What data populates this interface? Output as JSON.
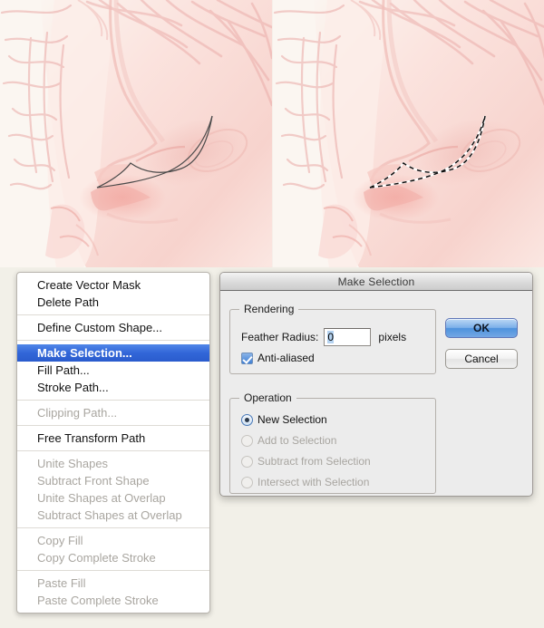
{
  "artwork": {
    "description": "digital-sketch-face-profile-lips",
    "left_panel_name": "path-view",
    "right_panel_name": "selection-view",
    "palette": {
      "paper": "#fbf6f1",
      "skin_light": "#fce7e2",
      "skin_mid": "#f6ccc6",
      "skin_shadow": "#eeb0ab",
      "sketch_line": "#e9a9a6",
      "path_stroke": "#4a4a4a",
      "marquee": "#111111"
    }
  },
  "context_menu": {
    "name": "paths-panel-context-menu",
    "groups": [
      {
        "items": [
          {
            "label": "Create Vector Mask",
            "state": "enabled"
          },
          {
            "label": "Delete Path",
            "state": "enabled"
          }
        ]
      },
      {
        "items": [
          {
            "label": "Define Custom Shape...",
            "state": "enabled"
          }
        ]
      },
      {
        "items": [
          {
            "label": "Make Selection...",
            "state": "selected"
          },
          {
            "label": "Fill Path...",
            "state": "enabled"
          },
          {
            "label": "Stroke Path...",
            "state": "enabled"
          }
        ]
      },
      {
        "items": [
          {
            "label": "Clipping Path...",
            "state": "disabled"
          }
        ]
      },
      {
        "items": [
          {
            "label": "Free Transform Path",
            "state": "enabled"
          }
        ]
      },
      {
        "items": [
          {
            "label": "Unite Shapes",
            "state": "disabled"
          },
          {
            "label": "Subtract Front Shape",
            "state": "disabled"
          },
          {
            "label": "Unite Shapes at Overlap",
            "state": "disabled"
          },
          {
            "label": "Subtract Shapes at Overlap",
            "state": "disabled"
          }
        ]
      },
      {
        "items": [
          {
            "label": "Copy Fill",
            "state": "disabled"
          },
          {
            "label": "Copy Complete Stroke",
            "state": "disabled"
          }
        ]
      },
      {
        "items": [
          {
            "label": "Paste Fill",
            "state": "disabled"
          },
          {
            "label": "Paste Complete Stroke",
            "state": "disabled"
          }
        ]
      }
    ]
  },
  "dialog": {
    "title": "Make Selection",
    "rendering": {
      "legend": "Rendering",
      "feather_label": "Feather Radius:",
      "feather_value": "0",
      "feather_unit": "pixels",
      "antialiased_label": "Anti-aliased",
      "antialiased_checked": true
    },
    "operation": {
      "legend": "Operation",
      "options": [
        {
          "label": "New Selection",
          "selected": true,
          "enabled": true
        },
        {
          "label": "Add to Selection",
          "selected": false,
          "enabled": false
        },
        {
          "label": "Subtract from Selection",
          "selected": false,
          "enabled": false
        },
        {
          "label": "Intersect with Selection",
          "selected": false,
          "enabled": false
        }
      ]
    },
    "buttons": {
      "ok": "OK",
      "cancel": "Cancel"
    },
    "accent_color": "#4e92dd"
  }
}
